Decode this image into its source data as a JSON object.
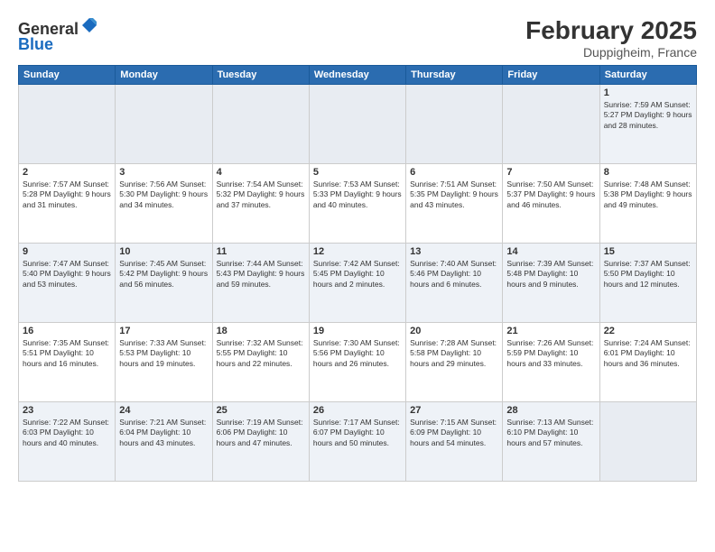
{
  "header": {
    "logo_line1": "General",
    "logo_line2": "Blue",
    "month": "February 2025",
    "location": "Duppigheim, France"
  },
  "weekdays": [
    "Sunday",
    "Monday",
    "Tuesday",
    "Wednesday",
    "Thursday",
    "Friday",
    "Saturday"
  ],
  "weeks": [
    [
      {
        "day": "",
        "info": ""
      },
      {
        "day": "",
        "info": ""
      },
      {
        "day": "",
        "info": ""
      },
      {
        "day": "",
        "info": ""
      },
      {
        "day": "",
        "info": ""
      },
      {
        "day": "",
        "info": ""
      },
      {
        "day": "1",
        "info": "Sunrise: 7:59 AM\nSunset: 5:27 PM\nDaylight: 9 hours and 28 minutes."
      }
    ],
    [
      {
        "day": "2",
        "info": "Sunrise: 7:57 AM\nSunset: 5:28 PM\nDaylight: 9 hours and 31 minutes."
      },
      {
        "day": "3",
        "info": "Sunrise: 7:56 AM\nSunset: 5:30 PM\nDaylight: 9 hours and 34 minutes."
      },
      {
        "day": "4",
        "info": "Sunrise: 7:54 AM\nSunset: 5:32 PM\nDaylight: 9 hours and 37 minutes."
      },
      {
        "day": "5",
        "info": "Sunrise: 7:53 AM\nSunset: 5:33 PM\nDaylight: 9 hours and 40 minutes."
      },
      {
        "day": "6",
        "info": "Sunrise: 7:51 AM\nSunset: 5:35 PM\nDaylight: 9 hours and 43 minutes."
      },
      {
        "day": "7",
        "info": "Sunrise: 7:50 AM\nSunset: 5:37 PM\nDaylight: 9 hours and 46 minutes."
      },
      {
        "day": "8",
        "info": "Sunrise: 7:48 AM\nSunset: 5:38 PM\nDaylight: 9 hours and 49 minutes."
      }
    ],
    [
      {
        "day": "9",
        "info": "Sunrise: 7:47 AM\nSunset: 5:40 PM\nDaylight: 9 hours and 53 minutes."
      },
      {
        "day": "10",
        "info": "Sunrise: 7:45 AM\nSunset: 5:42 PM\nDaylight: 9 hours and 56 minutes."
      },
      {
        "day": "11",
        "info": "Sunrise: 7:44 AM\nSunset: 5:43 PM\nDaylight: 9 hours and 59 minutes."
      },
      {
        "day": "12",
        "info": "Sunrise: 7:42 AM\nSunset: 5:45 PM\nDaylight: 10 hours and 2 minutes."
      },
      {
        "day": "13",
        "info": "Sunrise: 7:40 AM\nSunset: 5:46 PM\nDaylight: 10 hours and 6 minutes."
      },
      {
        "day": "14",
        "info": "Sunrise: 7:39 AM\nSunset: 5:48 PM\nDaylight: 10 hours and 9 minutes."
      },
      {
        "day": "15",
        "info": "Sunrise: 7:37 AM\nSunset: 5:50 PM\nDaylight: 10 hours and 12 minutes."
      }
    ],
    [
      {
        "day": "16",
        "info": "Sunrise: 7:35 AM\nSunset: 5:51 PM\nDaylight: 10 hours and 16 minutes."
      },
      {
        "day": "17",
        "info": "Sunrise: 7:33 AM\nSunset: 5:53 PM\nDaylight: 10 hours and 19 minutes."
      },
      {
        "day": "18",
        "info": "Sunrise: 7:32 AM\nSunset: 5:55 PM\nDaylight: 10 hours and 22 minutes."
      },
      {
        "day": "19",
        "info": "Sunrise: 7:30 AM\nSunset: 5:56 PM\nDaylight: 10 hours and 26 minutes."
      },
      {
        "day": "20",
        "info": "Sunrise: 7:28 AM\nSunset: 5:58 PM\nDaylight: 10 hours and 29 minutes."
      },
      {
        "day": "21",
        "info": "Sunrise: 7:26 AM\nSunset: 5:59 PM\nDaylight: 10 hours and 33 minutes."
      },
      {
        "day": "22",
        "info": "Sunrise: 7:24 AM\nSunset: 6:01 PM\nDaylight: 10 hours and 36 minutes."
      }
    ],
    [
      {
        "day": "23",
        "info": "Sunrise: 7:22 AM\nSunset: 6:03 PM\nDaylight: 10 hours and 40 minutes."
      },
      {
        "day": "24",
        "info": "Sunrise: 7:21 AM\nSunset: 6:04 PM\nDaylight: 10 hours and 43 minutes."
      },
      {
        "day": "25",
        "info": "Sunrise: 7:19 AM\nSunset: 6:06 PM\nDaylight: 10 hours and 47 minutes."
      },
      {
        "day": "26",
        "info": "Sunrise: 7:17 AM\nSunset: 6:07 PM\nDaylight: 10 hours and 50 minutes."
      },
      {
        "day": "27",
        "info": "Sunrise: 7:15 AM\nSunset: 6:09 PM\nDaylight: 10 hours and 54 minutes."
      },
      {
        "day": "28",
        "info": "Sunrise: 7:13 AM\nSunset: 6:10 PM\nDaylight: 10 hours and 57 minutes."
      },
      {
        "day": "",
        "info": ""
      }
    ]
  ]
}
